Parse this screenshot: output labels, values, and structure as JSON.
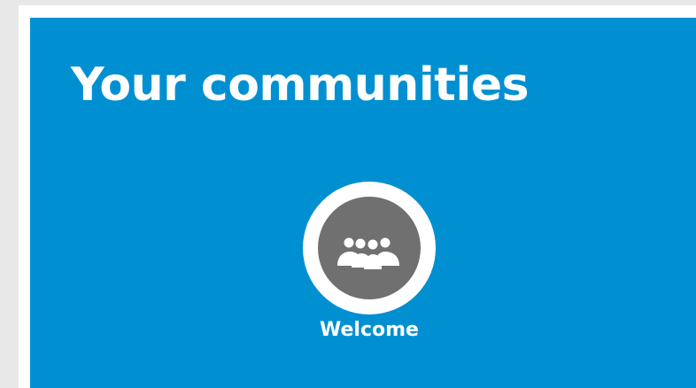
{
  "panel": {
    "title": "Your communities",
    "background_color": "#0090d2"
  },
  "communities": [
    {
      "label": "Welcome",
      "icon": "group-icon",
      "avatar_color": "#707070"
    }
  ]
}
